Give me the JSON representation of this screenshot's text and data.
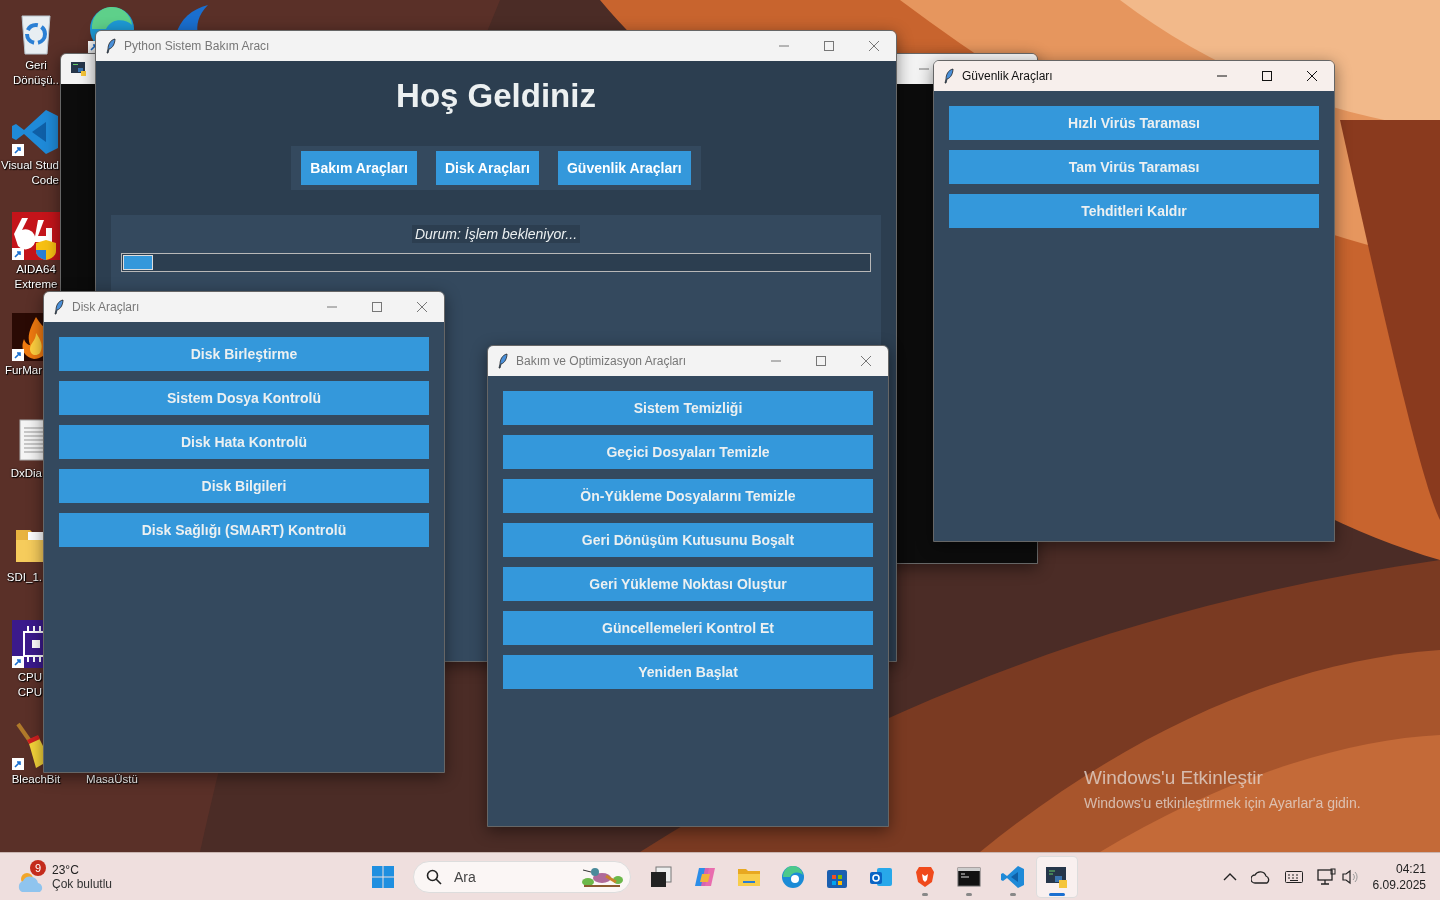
{
  "desktop_icons": [
    {
      "kind": "recycle-bin",
      "lines": [
        "Geri",
        "Dönüşü.."
      ]
    },
    {
      "kind": "browser",
      "shortcut": true
    },
    {
      "kind": "fin"
    },
    {
      "kind": "code-editor",
      "lines": [
        "Visual Stud",
        "Code"
      ],
      "shortcut": true
    },
    {
      "kind": "aida",
      "lines": [
        "AIDA64",
        "Extreme"
      ],
      "shortcut": true
    },
    {
      "kind": "flame",
      "lines": [
        "FurMar"
      ],
      "shortcut": true
    },
    {
      "kind": "document",
      "lines": [
        "DxDia"
      ]
    },
    {
      "kind": "folder",
      "lines": [
        "SDI_1."
      ]
    },
    {
      "kind": "chip",
      "lines": [
        "CPU",
        "CPU"
      ],
      "shortcut": true
    },
    {
      "kind": "broom",
      "lines": [
        "BleachBit"
      ],
      "shortcut": true
    },
    {
      "lines": [
        "MasaÜstü"
      ]
    }
  ],
  "console_window": {
    "active": false
  },
  "main_window": {
    "title": "Python Sistem Bakım Aracı",
    "active": false,
    "heading": "Hoş Geldiniz",
    "nav_buttons": [
      "Bakım Araçları",
      "Disk Araçları",
      "Güvenlik Araçları"
    ],
    "status": "Durum: İşlem bekleniyor...",
    "progress": {
      "level": 0.04
    }
  },
  "disk_window": {
    "title": "Disk Araçları",
    "active": false,
    "buttons": [
      "Disk Birleştirme",
      "Sistem Dosya Kontrolü",
      "Disk Hata Kontrolü",
      "Disk Bilgileri",
      "Disk Sağlığı (SMART) Kontrolü"
    ]
  },
  "maintenance_window": {
    "title": "Bakım ve Optimizasyon Araçları",
    "active": false,
    "buttons": [
      "Sistem Temizliği",
      "Geçici Dosyaları Temizle",
      "Ön-Yükleme Dosyalarını Temizle",
      "Geri Dönüşüm Kutusunu Boşalt",
      "Geri Yükleme Noktası Oluştur",
      "Güncellemeleri Kontrol Et",
      "Yeniden Başlat"
    ]
  },
  "security_window": {
    "title": "Güvenlik Araçları",
    "active": true,
    "buttons": [
      "Hızlı Virüs Taraması",
      "Tam Virüs Taraması",
      "Tehditleri Kaldır"
    ]
  },
  "activation_notice": {
    "title": "Windows'u Etkinleştir",
    "text": "Windows'u etkinleştirmek için Ayarlar'a gidin."
  },
  "taskbar": {
    "weather": {
      "badge": "9",
      "temperature": "23°C",
      "condition": "Çok bulutlu"
    },
    "search": {
      "placeholder": "Ara"
    },
    "apps": [
      {
        "kind": "task-view",
        "running": false,
        "selected": false
      },
      {
        "kind": "copilot",
        "running": false,
        "selected": false
      },
      {
        "kind": "files",
        "running": false,
        "selected": false
      },
      {
        "kind": "edge",
        "running": false,
        "selected": false
      },
      {
        "kind": "store",
        "running": false,
        "selected": false
      },
      {
        "kind": "outlook",
        "running": false,
        "selected": false
      },
      {
        "kind": "brave",
        "running": true,
        "selected": false
      },
      {
        "kind": "terminal",
        "running": true,
        "selected": false
      },
      {
        "kind": "vscode",
        "running": true,
        "selected": false
      },
      {
        "kind": "python",
        "running": true,
        "selected": true
      }
    ],
    "time": "04:21",
    "date": "6.09.2025"
  }
}
